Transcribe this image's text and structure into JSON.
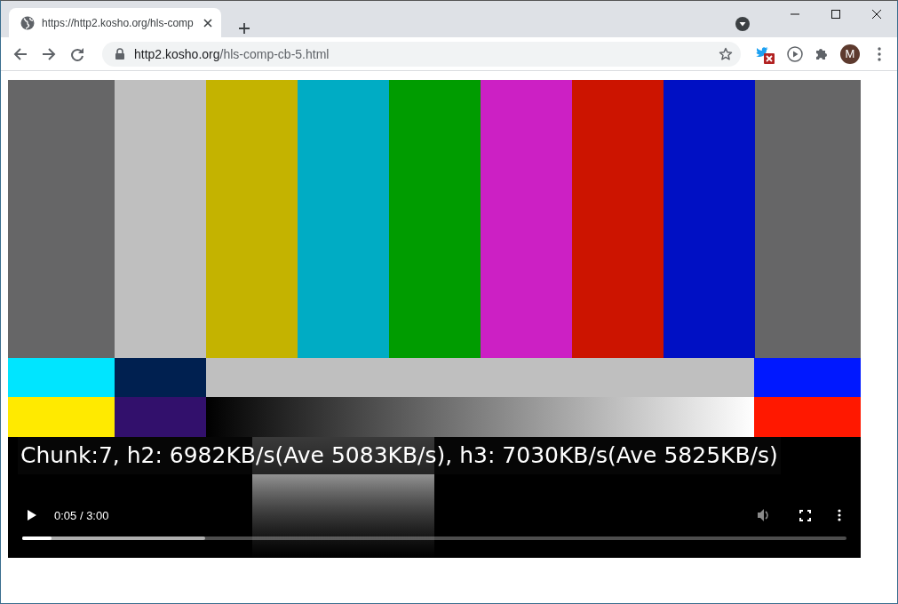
{
  "tabs": [
    {
      "title": "https://http2.kosho.org/hls-comp",
      "selected": true
    }
  ],
  "address": {
    "host": "http2.kosho.org",
    "path": "/hls-comp-cb-5.html"
  },
  "profile": {
    "initial": "M"
  },
  "video": {
    "caption": "Chunk:7, h2: 6982KB/s(Ave 5083KB/s), h3: 7030KB/s(Ave 5825KB/s)",
    "time": "0:05 / 3:00",
    "playing": false,
    "progress": {
      "played": {
        "level": 0.036
      },
      "buffered": {
        "level": 0.222
      }
    }
  }
}
